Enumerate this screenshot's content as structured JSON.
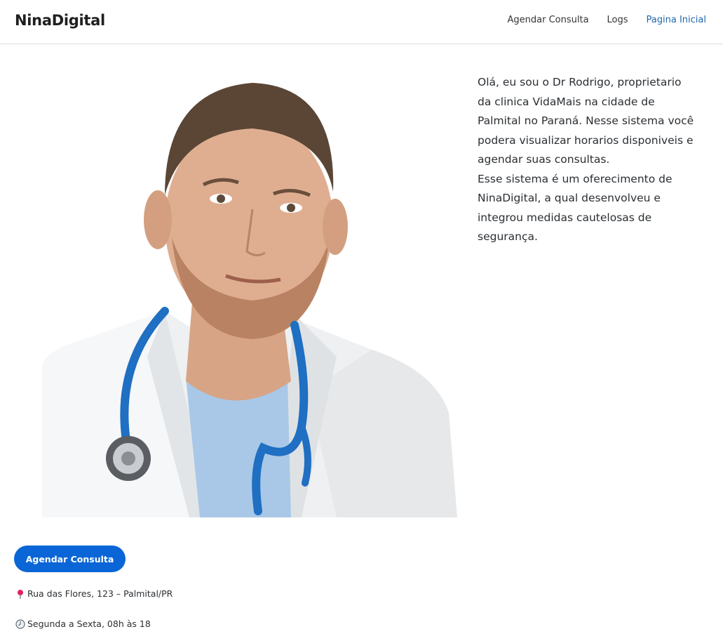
{
  "navbar": {
    "brand": "NinaDigital",
    "links": [
      {
        "label": "Agendar Consulta",
        "active": false
      },
      {
        "label": "Logs",
        "active": false
      },
      {
        "label": "Pagina Inicial",
        "active": true
      }
    ]
  },
  "hero": {
    "photo_icon": "doctor-portrait",
    "paragraphs": [
      "Olá, eu sou o Dr Rodrigo, proprietario da clinica VidaMais na cidade de Palmital no Paraná. Nesse sistema você podera visualizar horarios disponiveis e agendar suas consultas.",
      "Esse sistema é um oferecimento de NinaDigital, a qual desenvolveu e integrou medidas cautelosas de segurança."
    ]
  },
  "cta": {
    "label": "Agendar Consulta"
  },
  "info": {
    "address": "Rua das Flores, 123 – Palmital/PR",
    "address_icon": "pin-icon",
    "hours": "Segunda a Sexta, 08h às 18",
    "hours_icon": "clock-icon"
  },
  "colors": {
    "accent": "#0a66d6",
    "active_link": "#1f67ad"
  }
}
